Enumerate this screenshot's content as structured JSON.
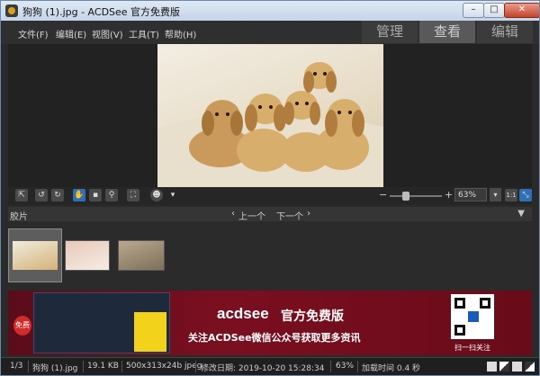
{
  "window": {
    "title": "狗狗 (1).jpg - ACDSee 官方免费版",
    "min": "–",
    "max": "□",
    "close": "✕"
  },
  "menu": [
    "文件(F)",
    "编辑(E)",
    "视图(V)",
    "工具(T)",
    "帮助(H)"
  ],
  "modes": [
    {
      "label": "管理",
      "active": false
    },
    {
      "label": "查看",
      "active": true
    },
    {
      "label": "编辑",
      "active": false
    }
  ],
  "photo": {
    "subject": "puppies"
  },
  "toolbar": {
    "zoom_value": "63%",
    "zoom_minus": "−",
    "zoom_plus": "+",
    "fit_label": "1:1"
  },
  "filmstrip": {
    "label": "胶片",
    "prev": "上一个",
    "next": "下一个"
  },
  "banner": {
    "brand": "acdsee",
    "headline": "官方免费版",
    "subline": "关注ACDSee微信公众号获取更多资讯",
    "badge": "免费",
    "qr_caption": "扫一扫关注"
  },
  "status": {
    "index": "1/3",
    "filename": "狗狗 (1).jpg",
    "size": "19.1 KB",
    "dims": "500x313x24b jpeg",
    "modified": "修改日期: 2019-10-20 15:28:34",
    "zoom": "63%",
    "load": "加载时间 0.4 秒"
  },
  "colors": {
    "accent": "#2f6fb6",
    "banner": "#7a0f20"
  }
}
